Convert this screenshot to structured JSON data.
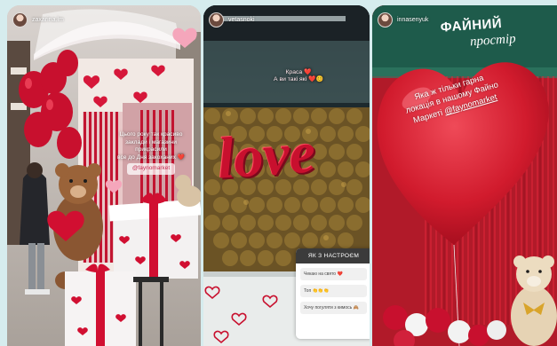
{
  "stories": [
    {
      "username": "zaxarina.lm",
      "caption_lines": [
        "Цього року так красиво",
        "заклади і магазини",
        "прикрасили",
        "все до Дня закоханих ❤️"
      ],
      "handle": "@faynomarket"
    },
    {
      "username": "vetasnoki",
      "caption_lines": [
        "Краса ❤️",
        "А ви такі які ❤️😊"
      ],
      "decor_word": "love",
      "poll": {
        "title": "ЯК З НАСТРОЄМ",
        "options": [
          "Чекаю на свято ❤️",
          "Топ 👏👏👏",
          "Хочу погуляти з кимось 🙈"
        ]
      }
    },
    {
      "username": "innasenyuk",
      "caption_lines": [
        "Яка ж тільки гарна",
        "локація в нашому Файно",
        "Маркеті"
      ],
      "handle": "@faynomarket",
      "sign_title": "ФАЙНИЙ",
      "sign_subtitle": "простір"
    }
  ],
  "colors": {
    "page_background": "#d6ecee",
    "heart_red": "#c8102e",
    "handle_pink": "#c52e53",
    "sign_green": "#1e5b4b"
  }
}
